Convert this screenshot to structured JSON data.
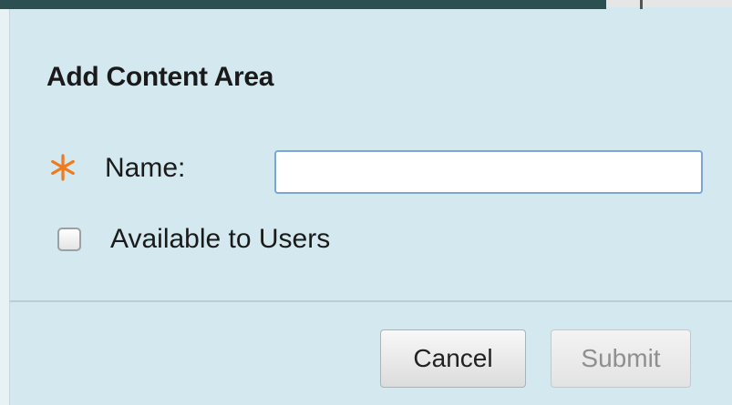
{
  "dialog": {
    "title": "Add Content Area",
    "name_field": {
      "label": "Name:",
      "value": "",
      "placeholder": "",
      "required": true,
      "required_icon": "asterisk-icon"
    },
    "available_checkbox": {
      "label": "Available to Users",
      "checked": false
    },
    "buttons": {
      "cancel_label": "Cancel",
      "submit_label": "Submit"
    }
  },
  "colors": {
    "panel_background": "#d3e9ef",
    "required_accent": "#f07b1c",
    "input_border": "#7aa7d6",
    "header_bar": "#2c4f52"
  }
}
